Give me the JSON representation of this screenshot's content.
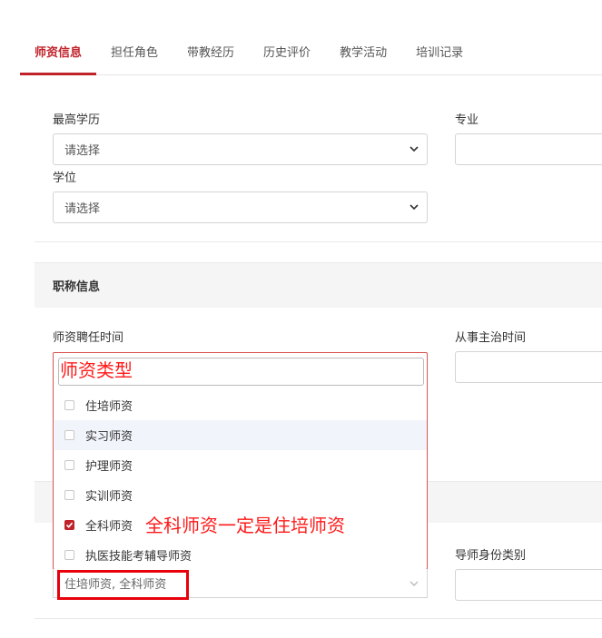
{
  "tabs": [
    {
      "label": "师资信息",
      "active": true
    },
    {
      "label": "担任角色"
    },
    {
      "label": "带教经历"
    },
    {
      "label": "历史评价"
    },
    {
      "label": "教学活动"
    },
    {
      "label": "培训记录"
    }
  ],
  "education": {
    "degree_label": "最高学历",
    "degree_value": "请选择",
    "major_label": "专业",
    "academic_degree_label": "学位",
    "academic_degree_value": "请选择"
  },
  "title_section": {
    "title": "职称信息",
    "hire_time_label": "师资聘任时间",
    "attending_time_label": "从事主治时间"
  },
  "teacher_type_dropdown": {
    "search_value": "",
    "options": [
      {
        "label": "住培师资",
        "checked": false
      },
      {
        "label": "实习师资",
        "checked": false
      },
      {
        "label": "护理师资",
        "checked": false
      },
      {
        "label": "实训师资",
        "checked": false
      },
      {
        "label": "全科师资",
        "checked": true
      },
      {
        "label": "执医技能考辅导师资",
        "checked": false
      }
    ],
    "selected_text": "住培师资, 全科师资"
  },
  "mentor_identity_label": "导师身份类别",
  "annotations": {
    "dropdown_note": "师资类型",
    "rule_note": "全科师资一定是住培师资"
  },
  "colors": {
    "accent": "#c0222a",
    "annotation": "#ff1a1a"
  }
}
